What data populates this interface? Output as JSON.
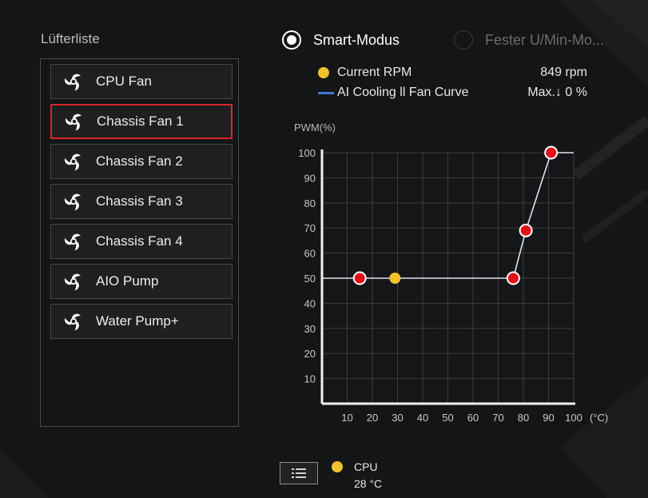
{
  "fan_list": {
    "title": "Lüfterliste",
    "items": [
      {
        "label": "CPU Fan",
        "selected": false
      },
      {
        "label": "Chassis Fan 1",
        "selected": true
      },
      {
        "label": "Chassis Fan 2",
        "selected": false
      },
      {
        "label": "Chassis Fan 3",
        "selected": false
      },
      {
        "label": "Chassis Fan 4",
        "selected": false
      },
      {
        "label": "AIO Pump",
        "selected": false
      },
      {
        "label": "Water Pump+",
        "selected": false
      }
    ]
  },
  "modes": {
    "smart": {
      "label": "Smart-Modus",
      "selected": true
    },
    "fixed": {
      "label": "Fester U/Min-Mo...",
      "selected": false
    }
  },
  "legend": {
    "current_rpm_label": "Current RPM",
    "current_rpm_value": "849 rpm",
    "curve_label": "AI Cooling ll Fan Curve",
    "curve_value": "Max.↓ 0 %"
  },
  "colors": {
    "accent_red": "#d8252c",
    "point_fill": "#e3101a",
    "current_point": "#f2c12e",
    "curve_line": "#3a7bd5"
  },
  "chart_data": {
    "type": "line",
    "ylabel": "PWM(%)",
    "xunit": "(°C)",
    "xticks": [
      10,
      20,
      30,
      40,
      50,
      60,
      70,
      80,
      90,
      100
    ],
    "yticks": [
      10,
      20,
      30,
      40,
      50,
      60,
      70,
      80,
      90,
      100
    ],
    "xlim": [
      0,
      100
    ],
    "ylim": [
      0,
      100
    ],
    "grid": true,
    "curve_points": [
      {
        "x": 15,
        "y": 50
      },
      {
        "x": 76,
        "y": 50
      },
      {
        "x": 81,
        "y": 69
      },
      {
        "x": 91,
        "y": 100
      }
    ],
    "current_point": {
      "x": 29,
      "y": 50
    }
  },
  "sensor": {
    "name": "CPU",
    "temperature": "28 °C",
    "button_icon": "list-icon"
  }
}
